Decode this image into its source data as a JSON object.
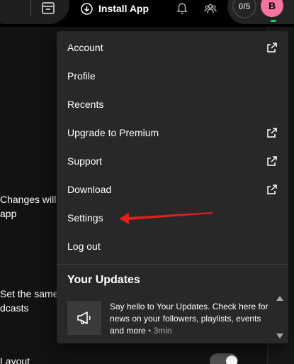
{
  "header": {
    "install_label": "Install App",
    "tasks_progress": "0/5",
    "avatar_initial": "B",
    "avatar_color": "#f573a0",
    "online_color": "#1ed760"
  },
  "background": {
    "line1a": "Changes will",
    "line1b": "app",
    "line2a": "Set the same",
    "line2b": "dcasts",
    "line3": "Layout"
  },
  "menu": {
    "items": [
      {
        "label": "Account",
        "external": true
      },
      {
        "label": "Profile",
        "external": false
      },
      {
        "label": "Recents",
        "external": false
      },
      {
        "label": "Upgrade to Premium",
        "external": true
      },
      {
        "label": "Support",
        "external": true
      },
      {
        "label": "Download",
        "external": true
      },
      {
        "label": "Settings",
        "external": false
      },
      {
        "label": "Log out",
        "external": false
      }
    ],
    "updates_title": "Your Updates",
    "update_text": "Say hello to Your Updates. Check here for news on your followers, playlists, events and more",
    "update_meta": "• 3min"
  },
  "icons": {
    "browse": "browse-icon",
    "install": "download-circle-icon",
    "bell": "bell-icon",
    "friends": "friends-icon",
    "external": "external-link-icon",
    "megaphone": "megaphone-icon"
  },
  "colors": {
    "annotation_arrow": "#e0201e",
    "menu_bg": "#282828"
  }
}
